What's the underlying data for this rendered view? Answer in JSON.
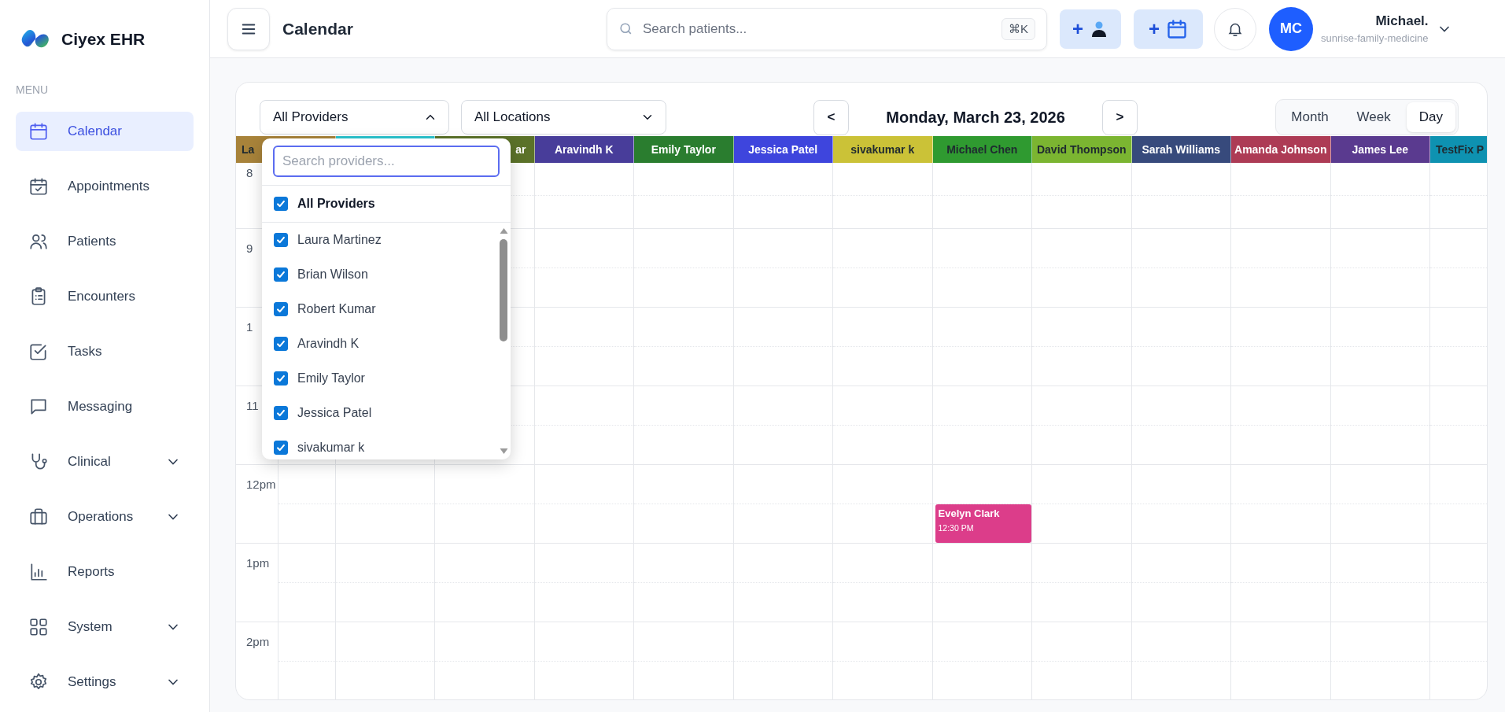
{
  "app": {
    "name": "Ciyex EHR"
  },
  "sidebar": {
    "section": "MENU",
    "items": [
      {
        "label": "Calendar",
        "selected": true,
        "has_submenu": false
      },
      {
        "label": "Appointments",
        "selected": false,
        "has_submenu": false
      },
      {
        "label": "Patients",
        "selected": false,
        "has_submenu": false
      },
      {
        "label": "Encounters",
        "selected": false,
        "has_submenu": false
      },
      {
        "label": "Tasks",
        "selected": false,
        "has_submenu": false
      },
      {
        "label": "Messaging",
        "selected": false,
        "has_submenu": false
      },
      {
        "label": "Clinical",
        "selected": false,
        "has_submenu": true
      },
      {
        "label": "Operations",
        "selected": false,
        "has_submenu": true
      },
      {
        "label": "Reports",
        "selected": false,
        "has_submenu": false
      },
      {
        "label": "System",
        "selected": false,
        "has_submenu": true
      },
      {
        "label": "Settings",
        "selected": false,
        "has_submenu": true
      }
    ]
  },
  "header": {
    "title": "Calendar",
    "search": {
      "placeholder": "Search patients...",
      "shortcut": "⌘K"
    },
    "add_buttons": [
      {
        "label": "+"
      },
      {
        "label": "+"
      }
    ],
    "user": {
      "initials": "MC",
      "name": "Michael.",
      "org": "sunrise-family-medicine"
    }
  },
  "calendar": {
    "filters": [
      {
        "value": "All Providers",
        "open": true
      },
      {
        "value": "All Locations",
        "open": false
      }
    ],
    "prev": "<",
    "date": "Monday, March 23, 2026",
    "next": ">",
    "views": [
      {
        "label": "Month",
        "selected": false
      },
      {
        "label": "Week",
        "selected": false
      },
      {
        "label": "Day",
        "selected": true
      }
    ],
    "columns": [
      {
        "label": "La",
        "color": "#a8833a",
        "dark_label": true,
        "kind": "cut-right"
      },
      {
        "color": "#2bc4cf",
        "kind": "hidden"
      },
      {
        "label": "ar",
        "color": "#5b7229",
        "dark_label": false,
        "kind": "cut-left"
      },
      {
        "label": "Aravindh K",
        "color": "#483d9a",
        "dark_label": false,
        "kind": "full"
      },
      {
        "label": "Emily Taylor",
        "color": "#2a7d2f",
        "dark_label": false,
        "kind": "full"
      },
      {
        "label": "Jessica Patel",
        "color": "#3e45dd",
        "dark_label": false,
        "kind": "full"
      },
      {
        "label": "sivakumar k",
        "color": "#cbc237",
        "dark_label": true,
        "kind": "full"
      },
      {
        "label": "Michael Chen",
        "color": "#2f9a30",
        "dark_label": true,
        "kind": "full",
        "events": [
          {
            "name": "Evelyn Clark",
            "time": "12:30 PM",
            "color": "#dc3d8a"
          }
        ]
      },
      {
        "label": "David Thompson",
        "color": "#7bb531",
        "dark_label": true,
        "kind": "full"
      },
      {
        "label": "Sarah Williams",
        "color": "#374a7c",
        "dark_label": false,
        "kind": "full"
      },
      {
        "label": "Amanda Johnson",
        "color": "#ad3b55",
        "dark_label": false,
        "kind": "full"
      },
      {
        "label": "James Lee",
        "color": "#5a3a8f",
        "dark_label": false,
        "kind": "full"
      },
      {
        "label": "TestFix P",
        "color": "#0e92b1",
        "dark_label": true,
        "kind": "cut-right"
      }
    ],
    "hours": [
      "8",
      "9",
      "1",
      "11",
      "12pm",
      "1pm",
      "2pm"
    ],
    "provider_menu": {
      "placeholder": "Search providers...",
      "all": {
        "label": "All Providers",
        "checked": true
      },
      "items": [
        {
          "label": "Laura Martinez",
          "checked": true
        },
        {
          "label": "Brian Wilson",
          "checked": true
        },
        {
          "label": "Robert Kumar",
          "checked": true
        },
        {
          "label": "Aravindh K",
          "checked": true
        },
        {
          "label": "Emily Taylor",
          "checked": true
        },
        {
          "label": "Jessica Patel",
          "checked": true
        },
        {
          "label": "sivakumar k",
          "checked": true
        }
      ]
    }
  }
}
